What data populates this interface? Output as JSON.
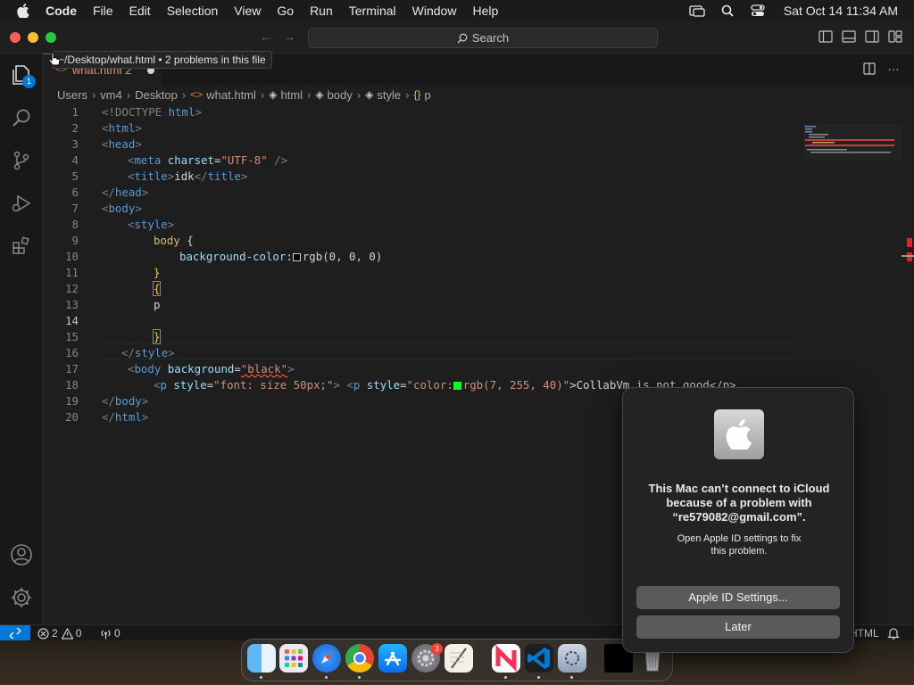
{
  "menubar": {
    "items": [
      "Code",
      "File",
      "Edit",
      "Selection",
      "View",
      "Go",
      "Run",
      "Terminal",
      "Window",
      "Help"
    ],
    "clock": "Sat Oct 14  11:34 AM"
  },
  "titlebar": {
    "search": "Search"
  },
  "activitybar": {
    "explorer_badge": "1"
  },
  "tab": {
    "label": "what.html 2"
  },
  "tooltip": "~/Desktop/what.html • 2 problems in this file",
  "breadcrumb": [
    "Users",
    "vm4",
    "Desktop",
    "what.html",
    "html",
    "body",
    "style",
    "p"
  ],
  "editor": {
    "line_numbers": [
      "1",
      "2",
      "3",
      "4",
      "5",
      "6",
      "7",
      "8",
      "9",
      "10",
      "11",
      "12",
      "13",
      "14",
      "15",
      "16",
      "17",
      "18",
      "19",
      "20"
    ],
    "lines": {
      "l1": {
        "a": "<!DOCTYPE",
        "b": " html",
        "c": ">"
      },
      "l2": {
        "a": "<",
        "b": "html",
        "c": ">"
      },
      "l3": {
        "a": "<",
        "b": "head",
        "c": ">"
      },
      "l4": {
        "a": "<",
        "b": "meta",
        "c": " charset",
        "d": "=",
        "e": "\"UTF-8\"",
        "f": " />"
      },
      "l5": {
        "a": "<",
        "b": "title",
        "c": ">",
        "d": "idk",
        "e": "</",
        "f": "title",
        "g": ">"
      },
      "l6": {
        "a": "</",
        "b": "head",
        "c": ">"
      },
      "l7": {
        "a": "<",
        "b": "body",
        "c": ">"
      },
      "l8": {
        "a": "<",
        "b": "style",
        "c": ">"
      },
      "l9": {
        "a": "body",
        "b": " {"
      },
      "l10": {
        "a": "background-color",
        "b": ":",
        "c": "rgb(0, 0, 0)"
      },
      "l11": {
        "a": "}"
      },
      "l12": {
        "a": "{"
      },
      "l13": {
        "a": "p"
      },
      "l15": {
        "a": "}"
      },
      "l16": {
        "a": "</",
        "b": "style",
        "c": ">"
      },
      "l17": {
        "a": "<",
        "b": "body",
        "c": " background",
        "d": "=",
        "e": "\"black\"",
        "f": ">"
      },
      "l18": {
        "a": "<",
        "b": "p",
        "c": " style",
        "d": "=",
        "e": "\"font: size 50px;\"",
        "f": "> ",
        "g": "<",
        "h": "p",
        "i": " style",
        "j": "=",
        "k": "\"color:",
        "l": "rgb(7, 255, 40)\"",
        "m": ">CollabVm is not good</p>"
      },
      "l19": {
        "a": "</",
        "b": "body",
        "c": ">"
      },
      "l20": {
        "a": "</",
        "b": "html",
        "c": ">"
      }
    },
    "swatches": {
      "black": "#000000",
      "green": "#07ff28"
    }
  },
  "statusbar": {
    "errors": "2",
    "warnings": "0",
    "ports": "0",
    "language": "HTML"
  },
  "dialog": {
    "title": "This Mac can’t connect to iCloud\nbecause of a problem with\n“re579082@gmail.com”.",
    "message": "Open Apple ID settings to fix\nthis problem.",
    "primary_button": "Apple ID Settings...",
    "secondary_button": "Later"
  },
  "dock": {
    "apps": [
      "finder-icon",
      "launchpad-icon",
      "safari-icon",
      "chrome-icon",
      "app-store-icon",
      "system-settings-icon",
      "textedit-icon",
      "news-icon",
      "vscode-icon",
      "utility-icon",
      "window-thumbnail-icon",
      "trash-icon"
    ],
    "settings_badge": "3"
  },
  "colors": {
    "accent": "#0078d4",
    "error": "#f48771",
    "dialog_bg": "#232325"
  }
}
